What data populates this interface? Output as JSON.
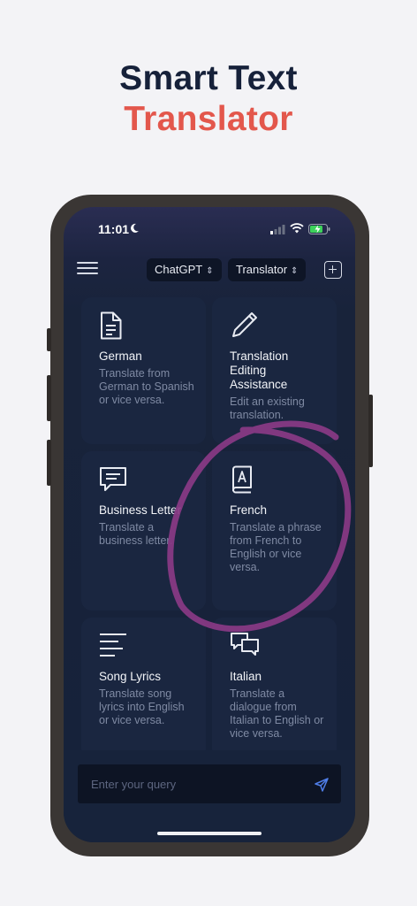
{
  "headline": {
    "line1": "Smart Text",
    "line2": "Translator"
  },
  "status_bar": {
    "time": "11:01"
  },
  "toolbar": {
    "model_label": "ChatGPT",
    "mode_label": "Translator"
  },
  "cards": [
    {
      "icon": "document-icon",
      "title": "German",
      "description": "Translate from German to Spanish or vice versa."
    },
    {
      "icon": "pencil-icon",
      "title": "Translation Editing Assistance",
      "description": "Edit an existing translation."
    },
    {
      "icon": "chat-bubble-icon",
      "title": "Business Letter",
      "description": "Translate a business letter."
    },
    {
      "icon": "dictionary-icon",
      "title": "French",
      "description": "Translate a phrase from French to English or vice versa."
    },
    {
      "icon": "lines-icon",
      "title": "Song Lyrics",
      "description": "Translate song lyrics into English or vice versa."
    },
    {
      "icon": "speech-bubbles-icon",
      "title": "Italian",
      "description": "Translate a dialogue from Italian to English or vice versa."
    }
  ],
  "query": {
    "placeholder": "Enter your query"
  },
  "colors": {
    "accent_red": "#e3574c",
    "navy": "#16213a",
    "circle_stroke": "#8a3a86"
  }
}
